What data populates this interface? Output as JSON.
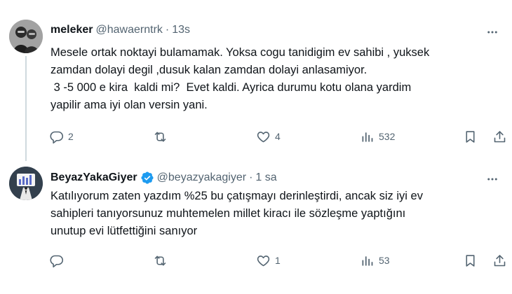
{
  "tweets": [
    {
      "display_name": "meleker",
      "handle": "@hawaerntrk",
      "separator": "·",
      "time": "13s",
      "verified": false,
      "lines": [
        "Mesele ortak noktayi bulamamak. Yoksa cogu tanidigim ev sahibi , yuksek",
        "zamdan dolayi degil ,dusuk kalan zamdan dolayi anlasamiyor.",
        " 3 -5 000 e kira  kaldi mi?  Evet kaldi. Ayrica durumu kotu olana yardim",
        "yapilir ama iyi olan versin yani."
      ],
      "replies": "2",
      "reposts": "",
      "likes": "4",
      "views": "532"
    },
    {
      "display_name": "BeyazYakaGiyer",
      "handle": "@beyazyakagiyer",
      "separator": "·",
      "time": "1 sa",
      "verified": true,
      "lines": [
        "Katılıyorum zaten yazdım %25 bu çatışmayı derinleştirdi, ancak siz iyi ev",
        "sahipleri tanıyorsunuz muhtemelen millet kiracı ile sözleşme yaptığını",
        "unutup evi lütfettiğini sanıyor"
      ],
      "replies": "",
      "reposts": "",
      "likes": "1",
      "views": "53"
    }
  ],
  "icons": {
    "reply": "reply-icon",
    "repost": "repost-icon",
    "like": "heart-icon",
    "views": "views-icon",
    "bookmark": "bookmark-icon",
    "share": "share-icon",
    "more": "more-icon",
    "verified": "verified-badge-icon"
  },
  "colors": {
    "text": "#0f1419",
    "secondary": "#536471",
    "verified": "#1d9bf0",
    "thread_line": "#cfd9de"
  }
}
